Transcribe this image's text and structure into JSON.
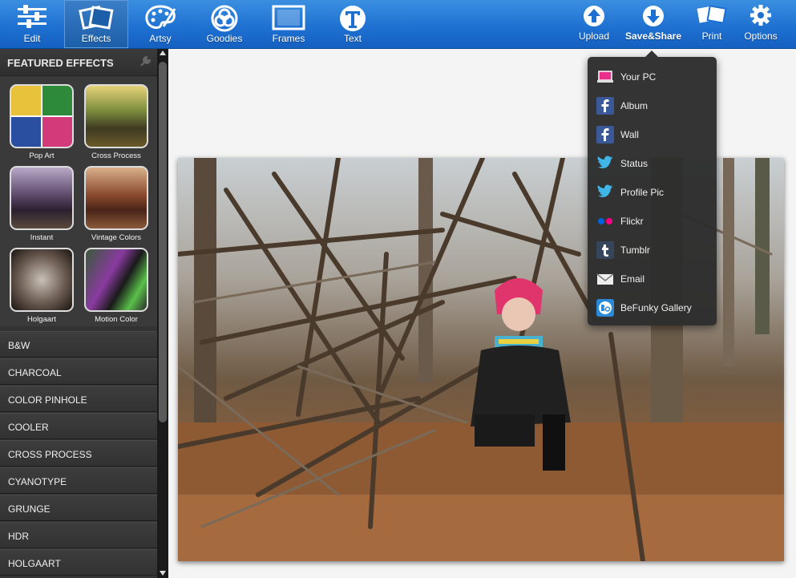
{
  "toolbar": {
    "tools": [
      {
        "label": "Edit"
      },
      {
        "label": "Effects"
      },
      {
        "label": "Artsy"
      },
      {
        "label": "Goodies"
      },
      {
        "label": "Frames"
      },
      {
        "label": "Text"
      }
    ],
    "actions": [
      {
        "label": "Upload"
      },
      {
        "label": "Save&Share"
      },
      {
        "label": "Print"
      },
      {
        "label": "Options"
      }
    ],
    "accent_color": "#1d6fd0"
  },
  "sidebar": {
    "featured_title": "FEATURED EFFECTS",
    "featured": [
      {
        "label": "Pop Art"
      },
      {
        "label": "Cross Process"
      },
      {
        "label": "Instant"
      },
      {
        "label": "Vintage Colors"
      },
      {
        "label": "Holgaart"
      },
      {
        "label": "Motion Color"
      }
    ],
    "categories": [
      "B&W",
      "CHARCOAL",
      "COLOR PINHOLE",
      "COOLER",
      "CROSS PROCESS",
      "CYANOTYPE",
      "GRUNGE",
      "HDR",
      "HOLGAART"
    ]
  },
  "share_menu": {
    "items": [
      {
        "label": "Your PC",
        "icon": "laptop-icon"
      },
      {
        "label": "Album",
        "icon": "facebook-icon"
      },
      {
        "label": "Wall",
        "icon": "facebook-icon"
      },
      {
        "label": "Status",
        "icon": "twitter-bird-icon"
      },
      {
        "label": "Profile Pic",
        "icon": "twitter-bird-icon"
      },
      {
        "label": "Flickr",
        "icon": "flickr-icon"
      },
      {
        "label": "Tumblr",
        "icon": "tumblr-icon"
      },
      {
        "label": "Email",
        "icon": "envelope-icon"
      },
      {
        "label": "BeFunky Gallery",
        "icon": "befunky-icon"
      }
    ]
  }
}
